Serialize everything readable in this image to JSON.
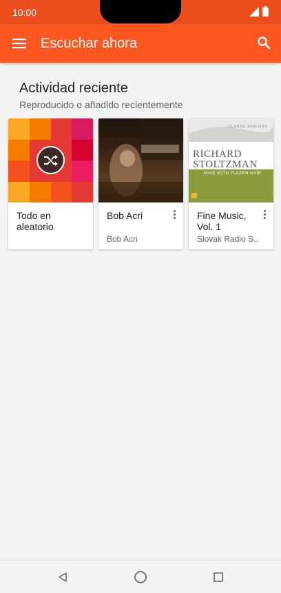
{
  "status_bar": {
    "time": "10:00"
  },
  "app_bar": {
    "title": "Escuchar ahora"
  },
  "section": {
    "title": "Actividad reciente",
    "subtitle": "Reproducido o añadido recientemente"
  },
  "cards": [
    {
      "title": "Todo en aleatorio",
      "subtitle": "",
      "art": "shuffle-mosaic"
    },
    {
      "title": "Bob Acri",
      "subtitle": "Bob Acri",
      "art": "piano-album-cover"
    },
    {
      "title": "Fine Music, Vol. 1",
      "subtitle": "Slovak Radio S..",
      "art": "richard-stoltzman-album-cover"
    }
  ],
  "album_cover": {
    "composer": "CLAUDE DEBUSSY",
    "artist_line1": "RICHARD",
    "artist_line2": "STOLTZMAN",
    "album": "MAID WITH FLAXEN HAIR"
  },
  "colors": {
    "status_bar": "#ea4e1c",
    "app_bar": "#ff5722",
    "background": "#f3f3f3",
    "cover_green": "#8a9c3c"
  },
  "icons": [
    "menu-icon",
    "search-icon",
    "shuffle-icon",
    "more-vert-icon",
    "back-icon",
    "home-icon",
    "recents-icon",
    "signal-icon",
    "battery-icon"
  ]
}
